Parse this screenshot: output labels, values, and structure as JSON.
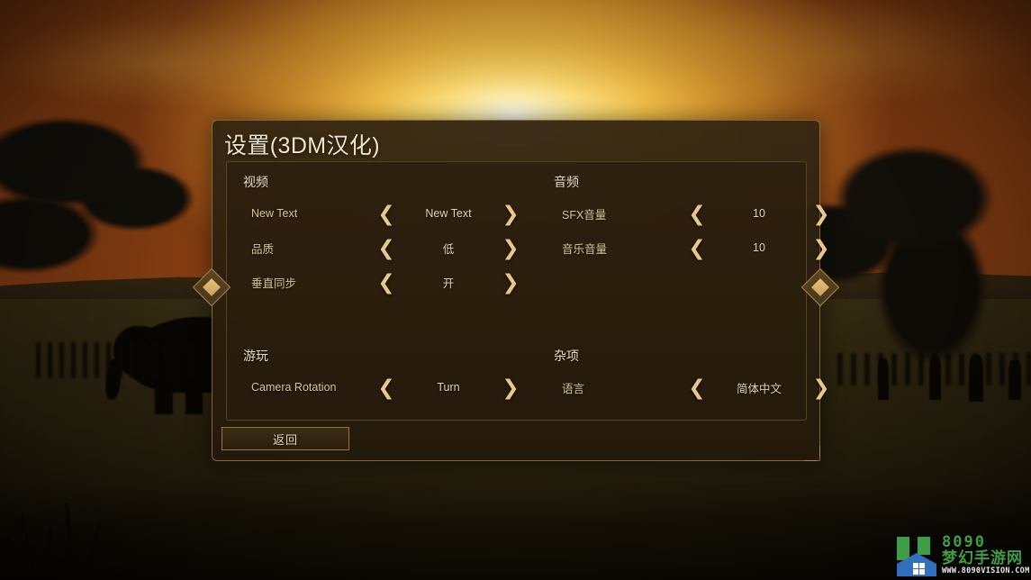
{
  "dialog": {
    "title": "设置(3DM汉化)",
    "back_button": "返回",
    "ornament_left": "diamond-ornament-left",
    "ornament_right": "diamond-ornament-right"
  },
  "sections": {
    "video": {
      "heading": "视频",
      "rows": [
        {
          "label": "New Text",
          "value": "New Text",
          "prev": "❮",
          "next": "❯"
        },
        {
          "label": "品质",
          "value": "低",
          "prev": "❮",
          "next": "❯"
        },
        {
          "label": "垂直同步",
          "value": "开",
          "prev": "❮",
          "next": "❯"
        }
      ]
    },
    "audio": {
      "heading": "音频",
      "rows": [
        {
          "label": "SFX音量",
          "value": "10",
          "prev": "❮",
          "next": "❯"
        },
        {
          "label": "音乐音量",
          "value": "10",
          "prev": "❮",
          "next": "❯"
        }
      ]
    },
    "gameplay": {
      "heading": "游玩",
      "rows": [
        {
          "label": "Camera Rotation",
          "value": "Turn",
          "prev": "❮",
          "next": "❯"
        }
      ]
    },
    "misc": {
      "heading": "杂项",
      "rows": [
        {
          "label": "语言",
          "value": "简体中文",
          "prev": "❮",
          "next": "❯"
        }
      ]
    }
  },
  "watermark": {
    "brand_number": "8090",
    "brand_cn": "梦幻手游网",
    "url": "WWW.8090VISION.COM"
  },
  "colors": {
    "panel_border": "#c4a062",
    "title_text": "#efe4cf",
    "label_text": "#d9c49a",
    "value_text": "#e3d3b2",
    "chevron": "#e7c88b",
    "accent_diamond": "#e8c27a",
    "watermark_green": "#3f9e45",
    "watermark_blue": "#2f6fbe"
  }
}
